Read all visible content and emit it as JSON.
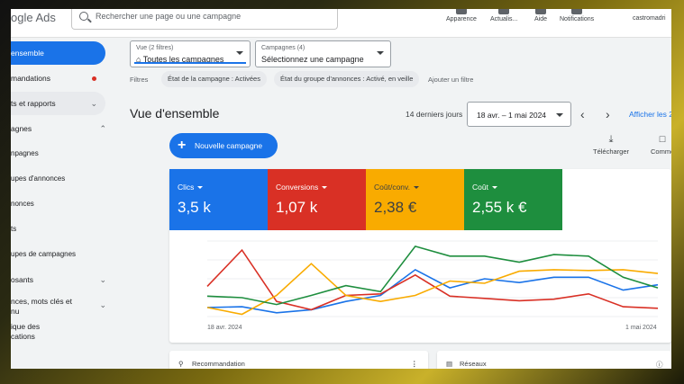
{
  "header": {
    "logo_text": "ogle Ads",
    "search_placeholder": "Rechercher une page ou une campagne",
    "items": [
      {
        "label": "Apparence",
        "icon": "appearance-icon"
      },
      {
        "label": "Actualis...",
        "icon": "refresh-icon"
      },
      {
        "label": "Aide",
        "icon": "help-icon"
      },
      {
        "label": "Notifications",
        "icon": "bell-icon"
      }
    ],
    "user": "castromadri"
  },
  "sidebar": {
    "items": [
      {
        "label": "ensemble",
        "state": "active"
      },
      {
        "label": "mandations",
        "notification_dot": true
      },
      {
        "label": "ts et rapports",
        "chevron": "down",
        "state": "selected"
      },
      {
        "label": "agnes",
        "chevron": "up"
      },
      {
        "label": "npagnes"
      },
      {
        "label": "upes d'annonces"
      },
      {
        "label": "nonces"
      },
      {
        "label": "ts"
      },
      {
        "label": "upes de campagnes"
      },
      {
        "label": "osants",
        "chevron": "down"
      },
      {
        "label": "nces, mots clés et",
        "label2": "nu",
        "chevron": "down"
      },
      {
        "label": "ique des",
        "label2": "cations"
      }
    ]
  },
  "filters": {
    "view": {
      "small": "Vue (2 filtres)",
      "value": "Toutes les campagnes"
    },
    "campaigns": {
      "small": "Campagnes (4)",
      "value": "Sélectionnez une campagne"
    },
    "label": "Filtres",
    "chips": [
      "État de la campagne : Activées",
      "État du groupe d'annonces : Activé, en veille"
    ],
    "add": "Ajouter un filtre"
  },
  "overview": {
    "title": "Vue d'ensemble",
    "range_label": "14 derniers jours",
    "date_range": "18 avr. – 1 mai 2024",
    "show_all": "Afficher les 2",
    "new_campaign": "Nouvelle campagne",
    "tools": [
      {
        "label": "Télécharger",
        "icon": "download-icon"
      },
      {
        "label": "Comme",
        "icon": "comment-icon"
      }
    ]
  },
  "metrics": [
    {
      "name": "Clics",
      "value": "3,5 k",
      "color": "#1a73e8"
    },
    {
      "name": "Conversions",
      "value": "1,07 k",
      "color": "#d93025"
    },
    {
      "name": "Coût/conv.",
      "value": "2,38 €",
      "color": "#f9ab00"
    },
    {
      "name": "Coût",
      "value": "2,55 k €",
      "color": "#1e8e3e"
    }
  ],
  "chart_data": {
    "type": "line",
    "x_labels": [
      "18 avr. 2024",
      "1 mai 2024"
    ],
    "series": [
      {
        "color": "#1a73e8",
        "values": [
          0.12,
          0.13,
          0.05,
          0.09,
          0.2,
          0.28,
          0.62,
          0.38,
          0.5,
          0.45,
          0.52,
          0.52,
          0.35,
          0.42
        ]
      },
      {
        "color": "#d93025",
        "values": [
          0.4,
          0.88,
          0.2,
          0.09,
          0.28,
          0.3,
          0.55,
          0.27,
          0.24,
          0.21,
          0.23,
          0.3,
          0.13,
          0.11
        ]
      },
      {
        "color": "#f9ab00",
        "values": [
          0.12,
          0.03,
          0.28,
          0.7,
          0.28,
          0.2,
          0.28,
          0.47,
          0.44,
          0.6,
          0.62,
          0.61,
          0.62,
          0.57
        ]
      },
      {
        "color": "#1e8e3e",
        "values": [
          0.27,
          0.25,
          0.16,
          0.28,
          0.41,
          0.33,
          0.93,
          0.8,
          0.8,
          0.72,
          0.82,
          0.8,
          0.52,
          0.38
        ]
      }
    ]
  },
  "bottom_cards": [
    {
      "title": "Recommandation",
      "icon": "bulb-icon"
    },
    {
      "title": "Réseaux",
      "icon": "bar-chart-icon"
    }
  ]
}
